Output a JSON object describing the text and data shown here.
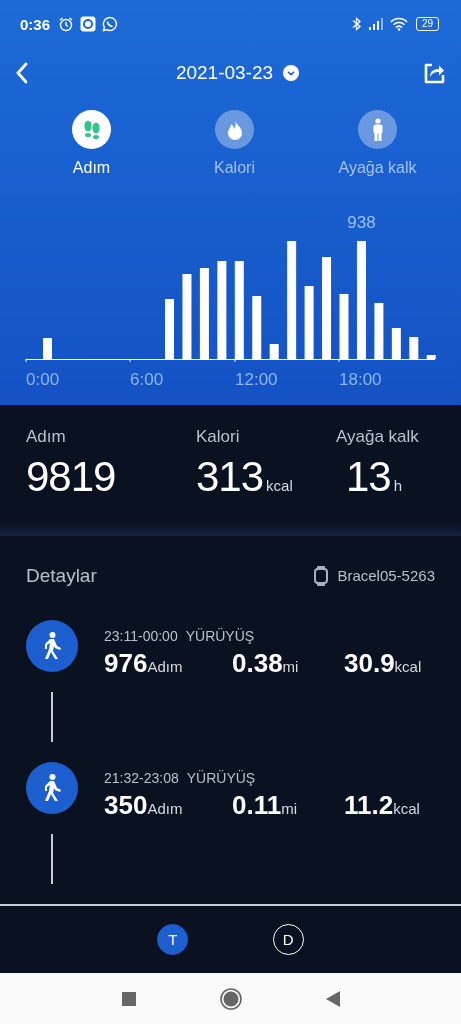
{
  "status_bar": {
    "time": "0:36",
    "battery": "29"
  },
  "header": {
    "date": "2021-03-23"
  },
  "tabs": [
    {
      "label": "Adım",
      "kind": "steps",
      "selected": true
    },
    {
      "label": "Kalori",
      "kind": "calories",
      "selected": false
    },
    {
      "label": "Ayağa kalk",
      "kind": "stand",
      "selected": false
    }
  ],
  "chart": {
    "x_labels": [
      "0:00",
      "6:00",
      "12:00",
      "18:00"
    ],
    "peak_label": "938"
  },
  "summary": [
    {
      "label": "Adım",
      "value": "9819"
    },
    {
      "label": "Kalori",
      "value": "313",
      "unit": "kcal"
    },
    {
      "label": "Ayağa kalk",
      "value": "13",
      "unit": "h"
    }
  ],
  "details": {
    "title": "Detaylar",
    "device": "Bracel05-5263",
    "activities": [
      {
        "time": "23:11-00:00",
        "type": "YÜRÜYÜŞ",
        "metrics": [
          {
            "value": "976",
            "unit": "Adım"
          },
          {
            "value": "0.38",
            "unit": "mi"
          },
          {
            "value": "30.9",
            "unit": "kcal"
          }
        ]
      },
      {
        "time": "21:32-23:08",
        "type": "YÜRÜYÜŞ",
        "metrics": [
          {
            "value": "350",
            "unit": "Adım"
          },
          {
            "value": "0.11",
            "unit": "mi"
          },
          {
            "value": "11.2",
            "unit": "kcal"
          }
        ]
      }
    ]
  },
  "bottom_tabs": [
    {
      "label": "T",
      "selected": true
    },
    {
      "label": "D",
      "selected": false
    }
  ]
}
